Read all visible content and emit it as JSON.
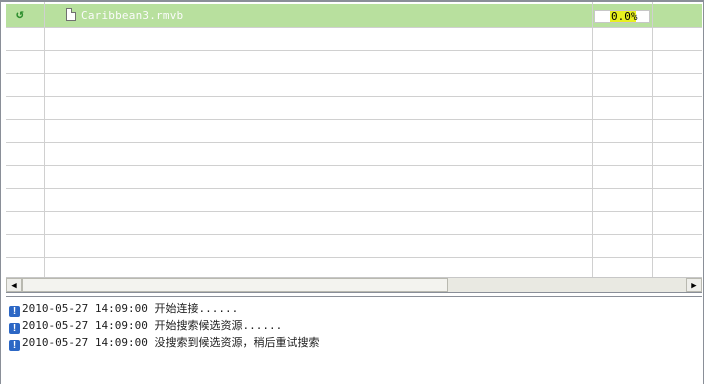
{
  "download_list": {
    "rows": [
      {
        "file_name": "Caribbean3.rmvb",
        "progress_text": "0.0%",
        "progress_percent": 0,
        "status_icon": "refresh-arrow-icon",
        "file_icon": "document-icon"
      }
    ]
  },
  "scrollbar": {
    "left_arrow": "◀",
    "right_arrow": "▶"
  },
  "log": {
    "icon": "info-icon",
    "entries": [
      {
        "timestamp": "2010-05-27 14:09:00",
        "message": "开始连接......"
      },
      {
        "timestamp": "2010-05-27 14:09:00",
        "message": "开始搜索候选资源......"
      },
      {
        "timestamp": "2010-05-27 14:09:00",
        "message": "没搜索到候选资源，稍后重试搜索"
      }
    ]
  },
  "colors": {
    "active_row": "#b8e09e",
    "progress_highlight": "#e8f020",
    "grid_line": "#d0d0d0",
    "log_icon": "#2c67c5"
  }
}
